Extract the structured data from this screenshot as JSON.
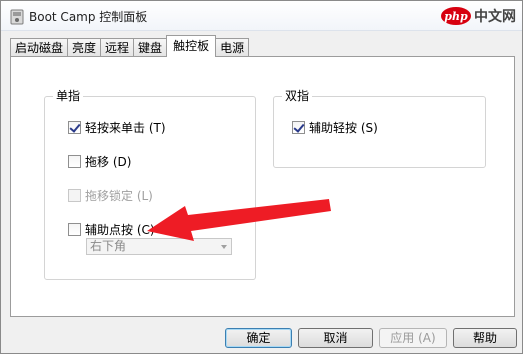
{
  "window": {
    "title": "Boot Camp 控制面板"
  },
  "watermark": {
    "brand": "php",
    "text": "中文网"
  },
  "tabs": [
    {
      "label": "启动磁盘"
    },
    {
      "label": "亮度"
    },
    {
      "label": "远程"
    },
    {
      "label": "键盘"
    },
    {
      "label": "触控板",
      "active": true
    },
    {
      "label": "电源"
    }
  ],
  "single_finger": {
    "title": "单指",
    "tap_to_click": {
      "label": "轻按来单击 (T)",
      "checked": true
    },
    "dragging": {
      "label": "拖移 (D)",
      "checked": false
    },
    "drag_lock": {
      "label": "拖移锁定 (L)",
      "checked": false,
      "disabled": true
    },
    "secondary_tap": {
      "label": "辅助点按 (C)",
      "checked": false
    },
    "corner_select": {
      "value": "右下角",
      "disabled": true
    }
  },
  "two_finger": {
    "title": "双指",
    "secondary_tap": {
      "label": "辅助轻按 (S)",
      "checked": true
    }
  },
  "buttons": {
    "ok": "确定",
    "cancel": "取消",
    "apply": "应用 (A)",
    "help": "帮助"
  },
  "colors": {
    "annotation_arrow": "#ee1c25",
    "window_bg": "#f0f0f0"
  }
}
